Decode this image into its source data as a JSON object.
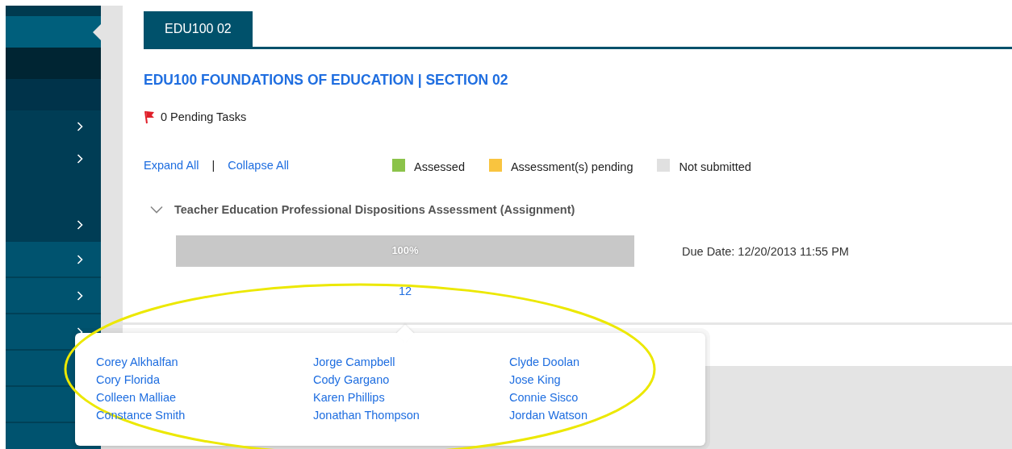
{
  "sidebar": {
    "items": [
      {
        "kind": "stub",
        "selected": false,
        "expandable": false
      },
      {
        "kind": "section",
        "selected": true,
        "expandable": false
      },
      {
        "kind": "blank",
        "selected": false,
        "expandable": false
      },
      {
        "kind": "section",
        "selected": false,
        "expandable": false
      },
      {
        "kind": "nested",
        "selected": false,
        "expandable": true
      },
      {
        "kind": "nested",
        "selected": false,
        "expandable": true
      },
      {
        "kind": "nested",
        "selected": false,
        "expandable": false
      },
      {
        "kind": "nested",
        "selected": false,
        "expandable": true
      },
      {
        "kind": "top",
        "selected": false,
        "expandable": true
      },
      {
        "kind": "top",
        "selected": false,
        "expandable": true
      },
      {
        "kind": "top",
        "selected": false,
        "expandable": true
      },
      {
        "kind": "top",
        "selected": false
      },
      {
        "kind": "top",
        "selected": false
      },
      {
        "kind": "top",
        "selected": false
      }
    ]
  },
  "tabs": [
    {
      "label": "EDU100 02",
      "selected": true
    }
  ],
  "course_title": "EDU100 FOUNDATIONS OF EDUCATION | SECTION 02",
  "pending_tasks": "0 Pending Tasks",
  "expand_all": "Expand All",
  "separator": "|",
  "collapse_all": "Collapse All",
  "legend": [
    {
      "label": "Assessed",
      "color": "#8bc34a"
    },
    {
      "label": "Assessment(s) pending",
      "color": "#f9c43f"
    },
    {
      "label": "Not submitted",
      "color": "#e0e0e0"
    }
  ],
  "assignment": {
    "title": "Teacher Education Professional Dispositions Assessment (Assignment)",
    "expanded": true,
    "progress": {
      "level": 1,
      "label": "100%"
    },
    "due_date": "Due Date: 12/20/2013 11:55 PM",
    "count": "12"
  },
  "students": [
    "Corey Alkhalfan",
    "Jorge Campbell",
    "Clyde Doolan",
    "Cory Florida",
    "Cody Gargano",
    "Jose King",
    "Colleen Malliae",
    "Karen Phillips",
    "Connie Sisco",
    "Constance Smith",
    "Jonathan Thompson",
    "Jordan Watson"
  ]
}
